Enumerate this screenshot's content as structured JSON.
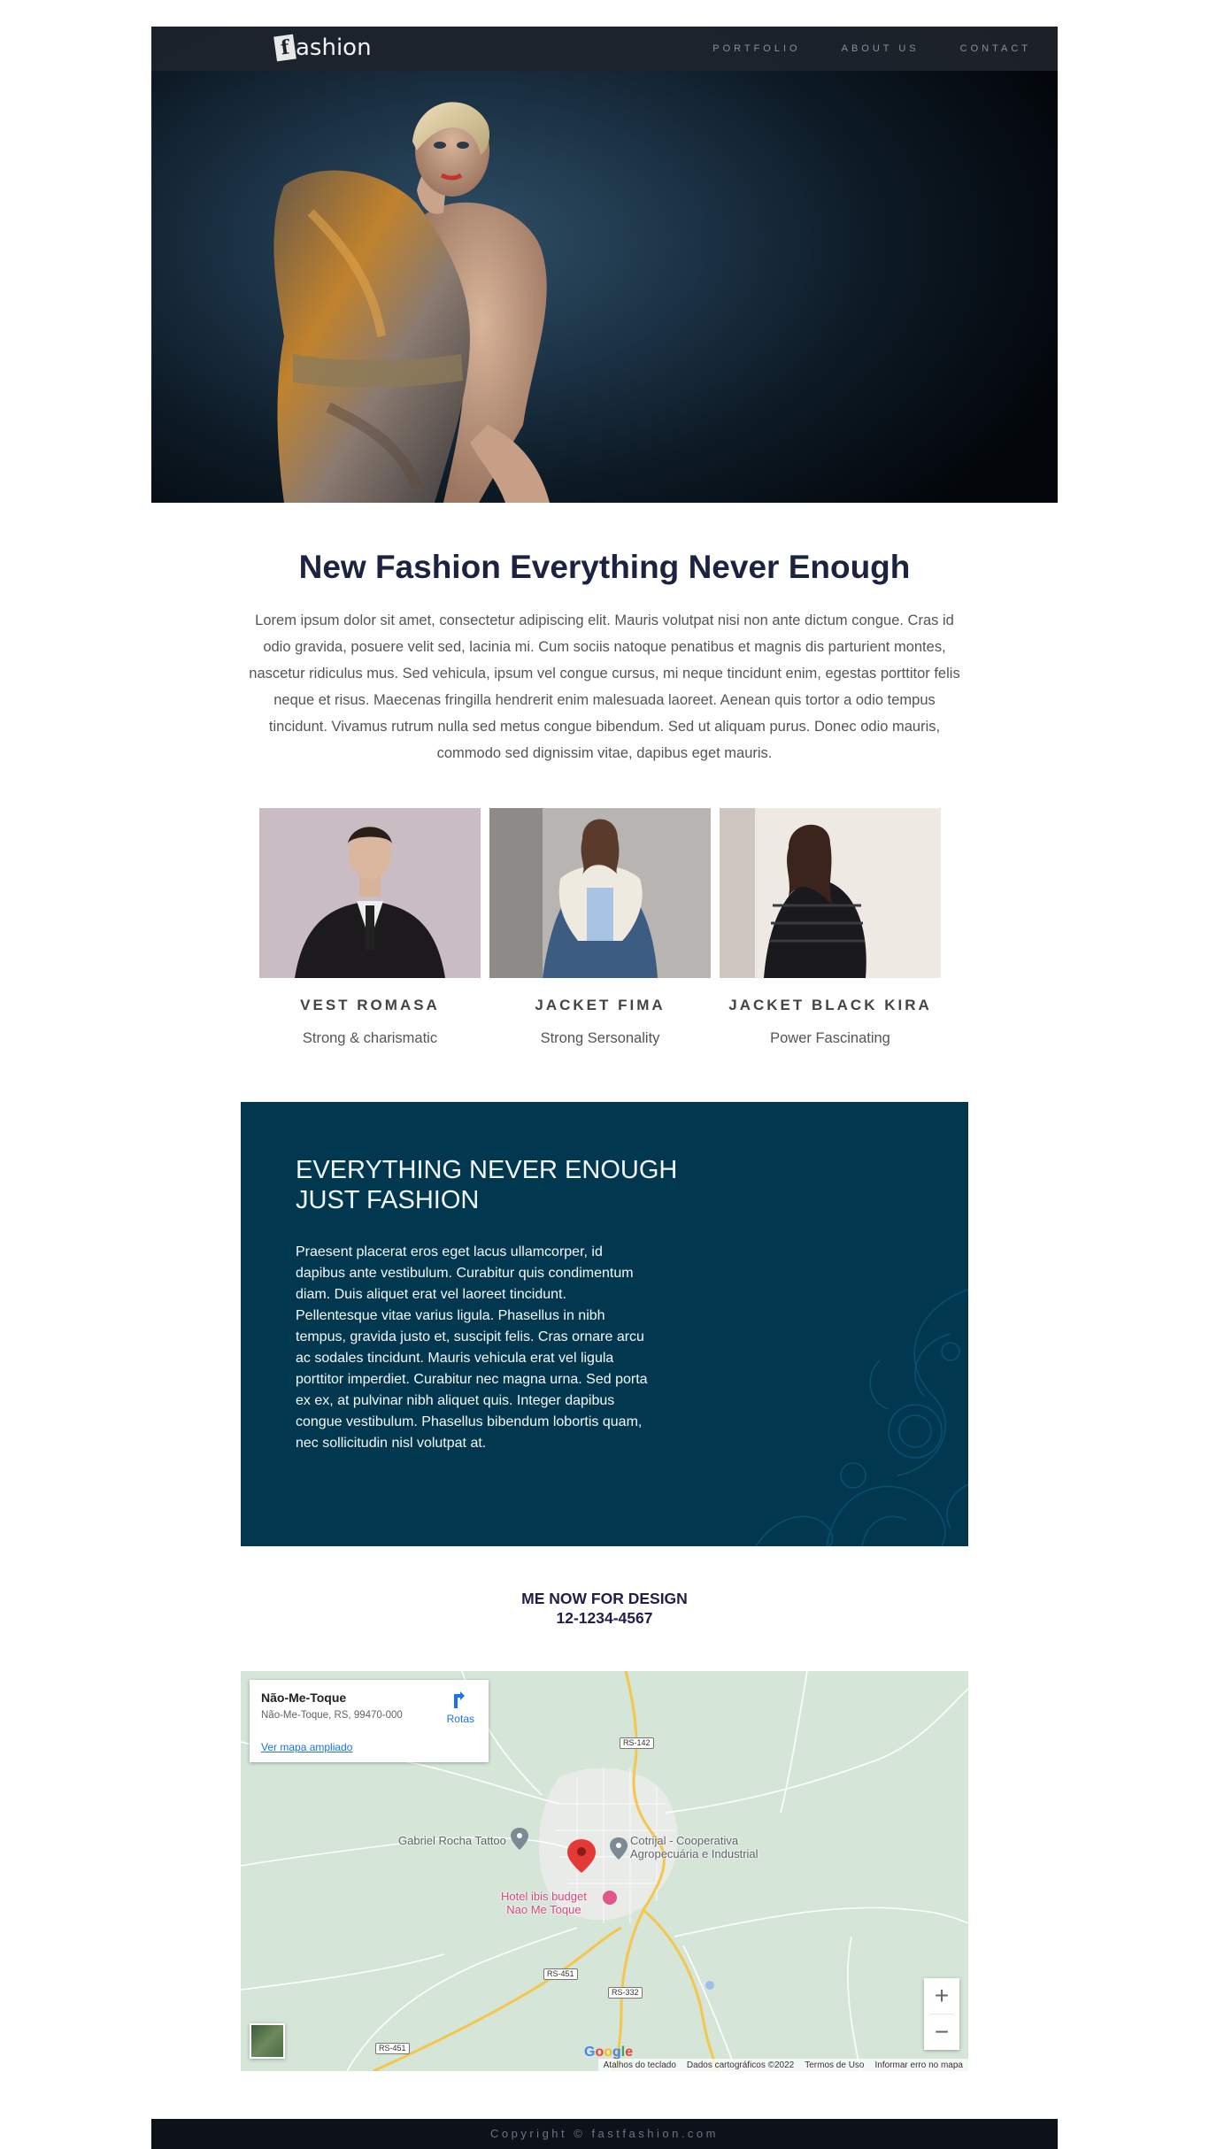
{
  "header": {
    "logo_mark": "f",
    "logo_text": "ashion",
    "nav": [
      "PORTFOLIO",
      "ABOUT US",
      "CONTACT"
    ]
  },
  "intro": {
    "title": "New Fashion Everything Never Enough",
    "text": "Lorem ipsum dolor sit amet, consectetur adipiscing elit. Mauris volutpat nisi non ante dictum congue. Cras id odio gravida, posuere velit sed, lacinia mi. Cum sociis natoque penatibus et magnis dis parturient montes, nascetur ridiculus mus. Sed vehicula, ipsum vel congue cursus, mi neque tincidunt enim, egestas porttitor felis neque et risus. Maecenas fringilla hendrerit enim malesuada laoreet. Aenean quis tortor a odio tempus tincidunt. Vivamus rutrum nulla sed metus congue bibendum. Sed ut aliquam purus. Donec odio mauris, commodo sed dignissim vitae, dapibus eget mauris."
  },
  "products": [
    {
      "name": "VEST ROMASA",
      "tagline": "Strong & charismatic"
    },
    {
      "name": "JACKET FIMA",
      "tagline": "Strong Sersonality"
    },
    {
      "name": "JACKET BLACK KIRA",
      "tagline": "Power Fascinating"
    }
  ],
  "feature": {
    "title_line1": "EVERYTHING NEVER ENOUGH",
    "title_line2": "JUST FASHION",
    "text": "Praesent placerat eros eget lacus ullamcorper, id dapibus ante vestibulum. Curabitur quis condimentum diam. Duis aliquet erat vel laoreet tincidunt. Pellentesque vitae varius ligula. Phasellus in nibh tempus, gravida justo et, suscipit felis. Cras ornare arcu ac sodales tincidunt. Mauris vehicula erat vel ligula porttitor imperdiet. Curabitur nec magna urna. Sed porta ex ex, at pulvinar nibh aliquet quis. Integer dapibus congue vestibulum. Phasellus bibendum lobortis quam, nec sollicitudin nisl volutpat at."
  },
  "contact": {
    "line1": "ME NOW FOR DESIGN",
    "phone": "12-1234-4567"
  },
  "map": {
    "place_name": "Não-Me-Toque",
    "address": "Não-Me-Toque, RS, 99470-000",
    "larger_map": "Ver mapa ampliado",
    "routes": "Rotas",
    "labels": {
      "tattoo": "Gabriel Rocha Tattoo",
      "coop_line1": "Cotrijal - Cooperativa",
      "coop_line2": "Agropecuária e Industrial",
      "hotel_line1": "Hotel ibis budget",
      "hotel_line2": "Nao Me Toque"
    },
    "roads": [
      "RS-142",
      "RS-451",
      "RS-332",
      "RS-451"
    ],
    "zoom_in": "+",
    "zoom_out": "−",
    "google": "Google",
    "footer_links": [
      "Atalhos do teclado",
      "Dados cartográficos ©2022",
      "Termos de Uso",
      "Informar erro no mapa"
    ]
  },
  "footer": {
    "copyright": "Copyright © fastfashion.com"
  },
  "colors": {
    "title": "#1c2340",
    "feature_bg": "#02384f",
    "footer_bg": "#0d121a",
    "map_bg": "#d7e8dc"
  }
}
